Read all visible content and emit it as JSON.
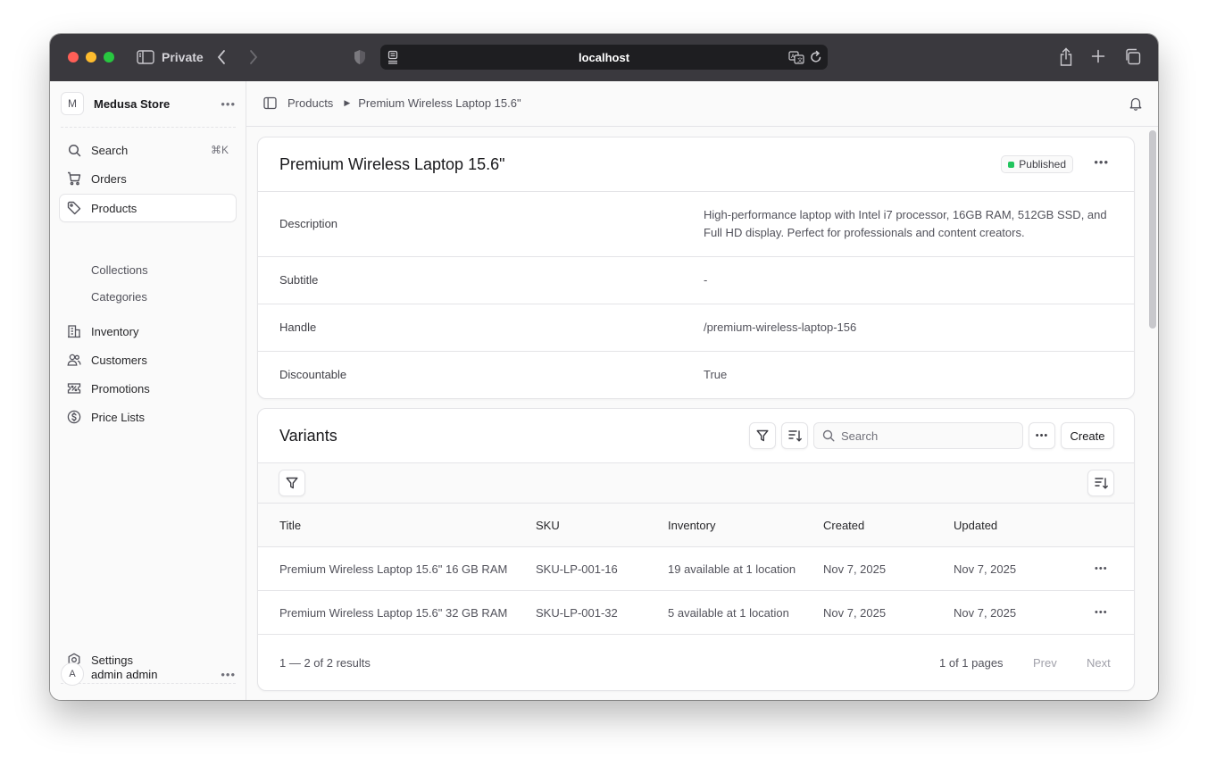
{
  "browser": {
    "private_label": "Private",
    "url": "localhost"
  },
  "sidebar": {
    "store_initial": "M",
    "store_name": "Medusa Store",
    "search": {
      "label": "Search",
      "shortcut": "⌘K"
    },
    "items": [
      {
        "label": "Orders",
        "icon": "cart-icon"
      },
      {
        "label": "Products",
        "icon": "tag-icon",
        "active": true
      },
      {
        "label": "Collections",
        "sub": true
      },
      {
        "label": "Categories",
        "sub": true
      },
      {
        "label": "Inventory",
        "icon": "building-icon"
      },
      {
        "label": "Customers",
        "icon": "users-icon"
      },
      {
        "label": "Promotions",
        "icon": "receipt-percent-icon"
      },
      {
        "label": "Price Lists",
        "icon": "currency-dollar-icon"
      }
    ],
    "settings_label": "Settings",
    "user_initial": "A",
    "user_name": "admin admin"
  },
  "breadcrumb": {
    "parent": "Products",
    "current": "Premium Wireless Laptop 15.6\""
  },
  "product": {
    "title": "Premium Wireless Laptop 15.6\"",
    "status": "Published",
    "status_color": "#22c55e",
    "fields": [
      {
        "key": "Description",
        "value": "High-performance laptop with Intel i7 processor, 16GB RAM, 512GB SSD, and Full HD display. Perfect for professionals and content creators."
      },
      {
        "key": "Subtitle",
        "value": "-"
      },
      {
        "key": "Handle",
        "value": "/premium-wireless-laptop-156"
      },
      {
        "key": "Discountable",
        "value": "True"
      }
    ]
  },
  "variants": {
    "title": "Variants",
    "search_placeholder": "Search",
    "create_label": "Create",
    "columns": [
      "Title",
      "SKU",
      "Inventory",
      "Created",
      "Updated"
    ],
    "rows": [
      [
        "Premium Wireless Laptop 15.6\" 16 GB RAM",
        "SKU-LP-001-16",
        "19 available at 1 location",
        "Nov 7, 2025",
        "Nov 7, 2025"
      ],
      [
        "Premium Wireless Laptop 15.6\" 32 GB RAM",
        "SKU-LP-001-32",
        "5 available at 1 location",
        "Nov 7, 2025",
        "Nov 7, 2025"
      ]
    ],
    "results_text": "1 — 2 of 2 results",
    "pages_text": "1 of 1 pages",
    "prev_label": "Prev",
    "next_label": "Next"
  }
}
